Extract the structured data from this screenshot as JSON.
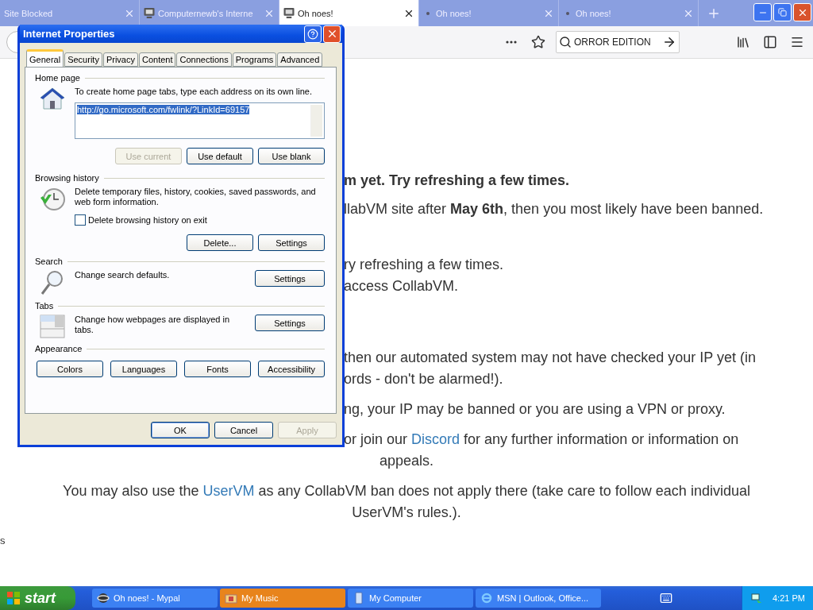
{
  "browser_tabs": [
    {
      "title": "Site Blocked",
      "kind": "plain",
      "selected": false
    },
    {
      "title": "Computernewb's Interne",
      "kind": "computer",
      "selected": false
    },
    {
      "title": "Oh noes!",
      "kind": "computer",
      "selected": true
    },
    {
      "title": "Oh noes!",
      "kind": "dot",
      "selected": false
    },
    {
      "title": "Oh noes!",
      "kind": "dot",
      "selected": false
    }
  ],
  "search_field": {
    "value": "ORROR EDITION"
  },
  "page": {
    "paragraphs": [
      {
        "lines": [
          {
            "kind": "fragment",
            "bold": true,
            "segments": [
              {
                "kind": "plain",
                "text": "m yet. Try refreshing a few times."
              }
            ]
          }
        ]
      },
      {
        "lines": [
          {
            "kind": "fragment",
            "bold": false,
            "segments": [
              {
                "kind": "plain",
                "text": "llabVM site after **May 6th**, then you most likely have been banned."
              }
            ]
          }
        ]
      },
      {
        "lines": [
          {
            "kind": "fragment",
            "bold": false,
            "segments": [
              {
                "kind": "plain",
                "text": "ry refreshing a few times."
              }
            ]
          },
          {
            "kind": "fragment",
            "bold": false,
            "segments": [
              {
                "kind": "plain",
                "text": "access CollabVM."
              }
            ]
          }
        ]
      },
      {
        "lines": [
          {
            "kind": "fragment",
            "bold": false,
            "segments": [
              {
                "kind": "plain",
                "text": "then our automated system may not have checked your IP yet (in"
              }
            ]
          },
          {
            "kind": "fragment",
            "bold": false,
            "segments": [
              {
                "kind": "plain",
                "text": "ords - don't be alarmed!)."
              }
            ]
          }
        ]
      },
      {
        "lines": [
          {
            "kind": "fragment",
            "bold": false,
            "segments": [
              {
                "kind": "plain",
                "text": "ng, your IP may be banned or you are using a VPN or proxy."
              }
            ]
          }
        ]
      },
      {
        "lines": [
          {
            "kind": "fragment",
            "bold": false,
            "segments": [
              {
                "kind": "plain",
                "text": "or join our"
              },
              {
                "kind": "link",
                "text": "Discord"
              },
              {
                "kind": "plain",
                "text": "for any further information or information on"
              }
            ]
          },
          {
            "kind": "centered",
            "bold": false,
            "segments": [
              {
                "kind": "plain",
                "text": "appeals."
              }
            ]
          }
        ]
      },
      {
        "lines": [
          {
            "kind": "centered",
            "bold": false,
            "segments": [
              {
                "kind": "plain",
                "text": "You may also use the"
              },
              {
                "kind": "link",
                "text": "UserVM"
              },
              {
                "kind": "plain",
                "text": "as any CollabVM ban does not apply there (take care to follow each individual"
              }
            ]
          },
          {
            "kind": "centered",
            "bold": false,
            "segments": [
              {
                "kind": "plain",
                "text": "UserVM's rules.)."
              }
            ]
          }
        ]
      },
      {
        "lines": [
          {
            "kind": "edge",
            "bold": false,
            "segments": [
              {
                "kind": "plain",
                "text": "s"
              }
            ]
          }
        ]
      }
    ]
  },
  "dialog": {
    "title": "Internet Properties",
    "tabs": [
      {
        "label": "General",
        "selected": true
      },
      {
        "label": "Security",
        "selected": false
      },
      {
        "label": "Privacy",
        "selected": false
      },
      {
        "label": "Content",
        "selected": false
      },
      {
        "label": "Connections",
        "selected": false
      },
      {
        "label": "Programs",
        "selected": false
      },
      {
        "label": "Advanced",
        "selected": false
      }
    ],
    "home_page": {
      "heading": "Home page",
      "text": "To create home page tabs, type each address on its own line.",
      "value": "http://go.microsoft.com/fwlink/?LinkId=69157",
      "buttons": [
        {
          "label": "Use current",
          "disabled": true
        },
        {
          "label": "Use default",
          "disabled": false
        },
        {
          "label": "Use blank",
          "disabled": false
        }
      ]
    },
    "browsing_history": {
      "heading": "Browsing history",
      "text": "Delete temporary files, history, cookies, saved passwords, and web form information.",
      "checkbox": {
        "label": "Delete browsing history on exit",
        "checked": false
      },
      "buttons": [
        {
          "label": "Delete...",
          "disabled": false
        },
        {
          "label": "Settings",
          "disabled": false
        }
      ]
    },
    "search": {
      "heading": "Search",
      "text": "Change search defaults.",
      "button": "Settings"
    },
    "tabs_section": {
      "heading": "Tabs",
      "text": "Change how webpages are displayed in tabs.",
      "button": "Settings"
    },
    "appearance": {
      "heading": "Appearance",
      "buttons": [
        "Colors",
        "Languages",
        "Fonts",
        "Accessibility"
      ]
    },
    "footer_buttons": [
      {
        "label": "OK",
        "disabled": false,
        "default": true
      },
      {
        "label": "Cancel",
        "disabled": false,
        "default": false
      },
      {
        "label": "Apply",
        "disabled": true,
        "default": false
      }
    ]
  },
  "taskbar": {
    "start": "start",
    "tasks": [
      {
        "label": "Oh noes! - Mypal",
        "kind": "browser",
        "highlighted": false
      },
      {
        "label": "My Music",
        "kind": "folder",
        "highlighted": true
      },
      {
        "label": "My Computer",
        "kind": "computer",
        "highlighted": false
      },
      {
        "label": "MSN | Outlook, Office...",
        "kind": "ie",
        "highlighted": false
      }
    ],
    "clock": "4:21 PM"
  }
}
